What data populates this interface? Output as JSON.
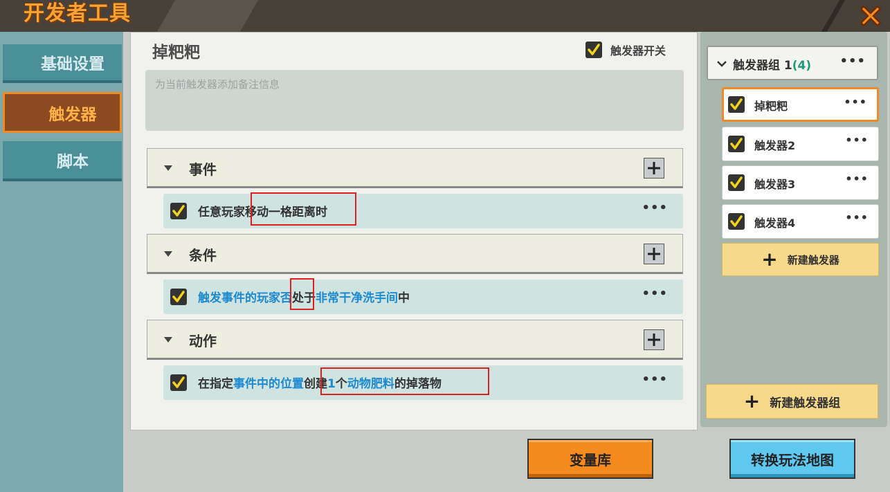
{
  "window": {
    "title": "开发者工具",
    "overlay_text": "",
    "close_icon": "close-x-icon"
  },
  "nav": {
    "items": [
      {
        "label": "基础设置",
        "active": false
      },
      {
        "label": "触发器",
        "active": true
      },
      {
        "label": "脚本",
        "active": false
      }
    ]
  },
  "trigger": {
    "name": "掉粑粑",
    "switch_label": "触发器开关",
    "switch_checked": true,
    "note_placeholder": "为当前触发器添加备注信息"
  },
  "sections": {
    "event": {
      "title": "事件",
      "row": {
        "seg1": "任意玩家",
        "seg2": "移动一格距离时",
        "checked": true
      }
    },
    "condition": {
      "title": "条件",
      "row": {
        "seg1": "触发事件的玩家",
        "seg2": "否",
        "seg3": "处于",
        "seg4": "非常干净洗手间",
        "seg5": "中",
        "checked": true
      }
    },
    "action": {
      "title": "动作",
      "row": {
        "seg1": "在指定",
        "seg2": "事件中的位置",
        "seg3": "创建",
        "seg4": "1",
        "seg5": "个",
        "seg6": "动物肥料",
        "seg7": "的掉落物",
        "checked": true
      }
    }
  },
  "sidebar": {
    "group": {
      "label": "触发器组 1",
      "count": "(4)"
    },
    "triggers": [
      {
        "label": "掉粑粑",
        "checked": true,
        "selected": true
      },
      {
        "label": "触发器2",
        "checked": true,
        "selected": false
      },
      {
        "label": "触发器3",
        "checked": true,
        "selected": false
      },
      {
        "label": "触发器4",
        "checked": true,
        "selected": false
      }
    ],
    "new_trigger": "新建触发器",
    "new_group": "新建触发器组"
  },
  "footer": {
    "variable_library": "变量库",
    "convert_map": "转换玩法地图"
  },
  "colors": {
    "accent_orange": "#f08a26",
    "link_blue": "#1d8ad0",
    "highlight_red": "#e02020",
    "nav_teal": "#4a8e97"
  },
  "more_glyph": "•••"
}
